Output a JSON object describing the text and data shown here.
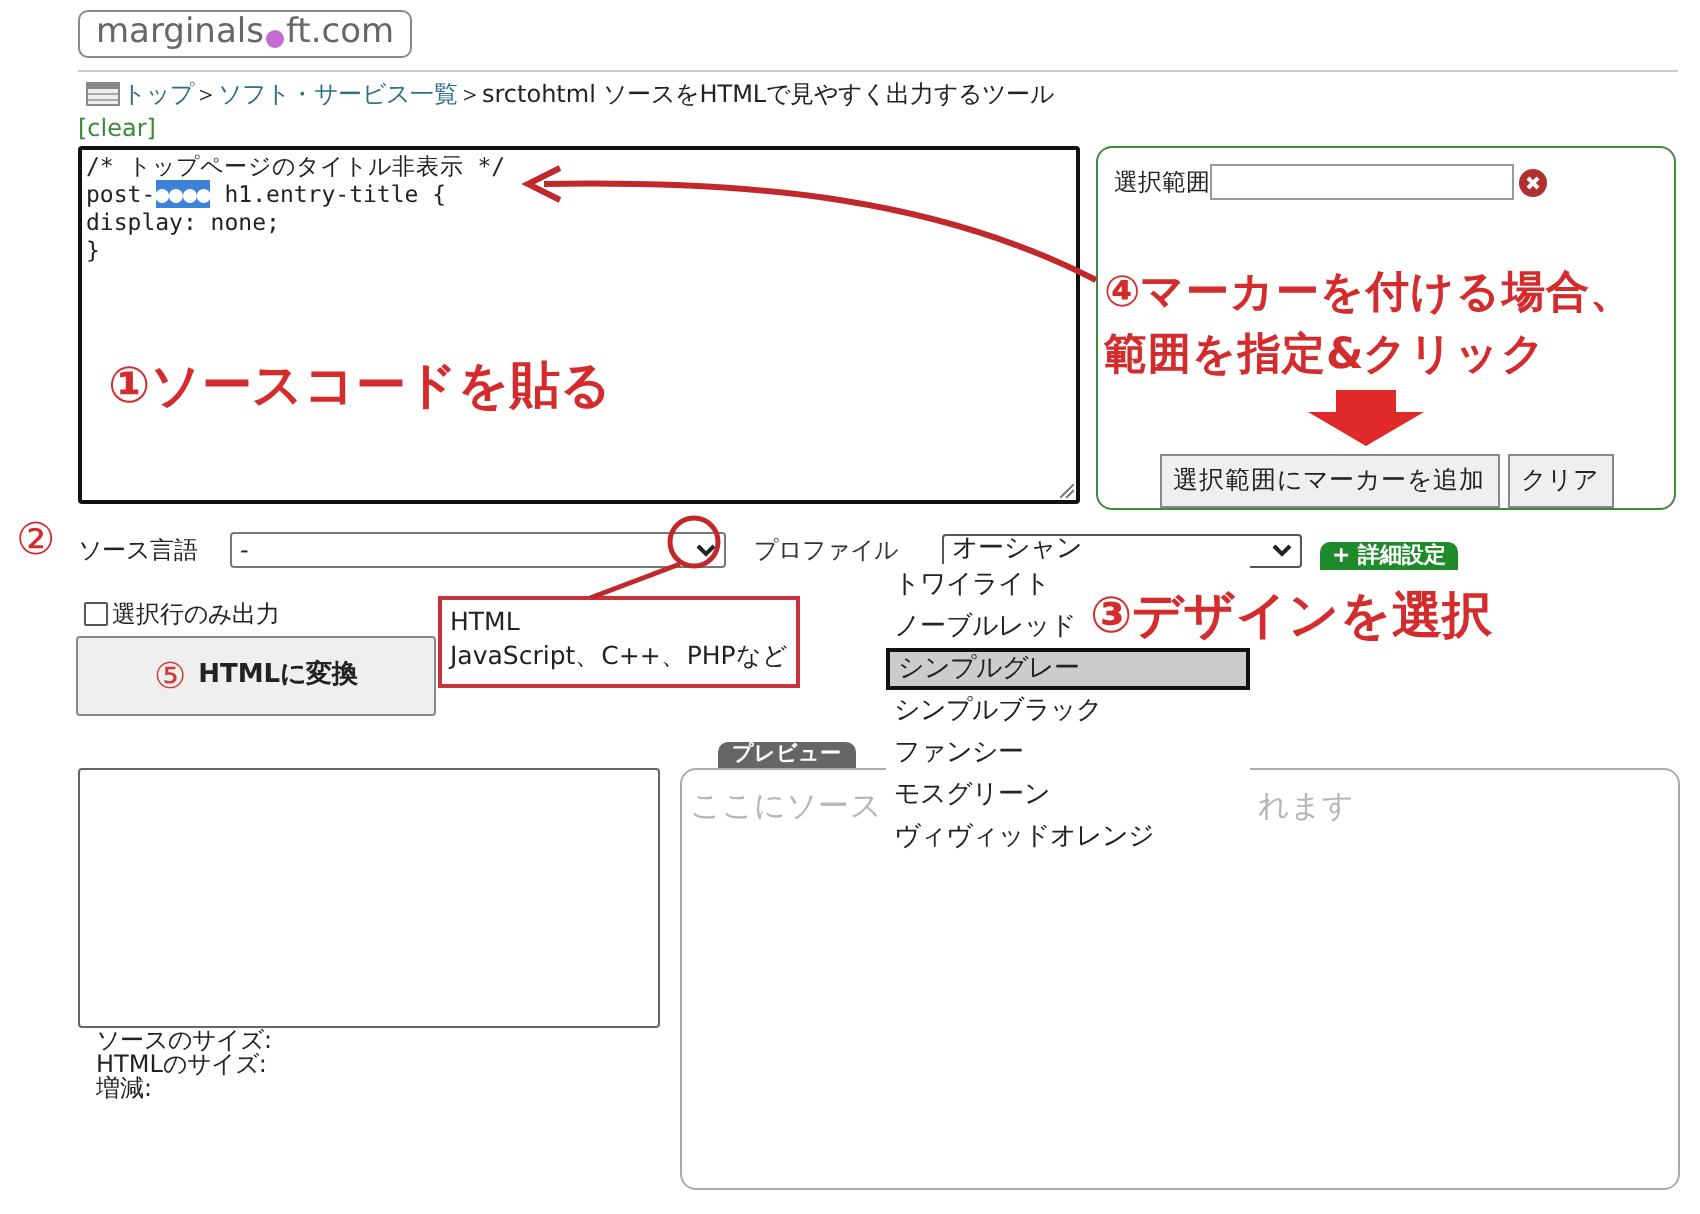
{
  "logo": {
    "text_before": "marginals",
    "text_after": "ft.com"
  },
  "breadcrumb": [
    {
      "kind": "link",
      "text": "トップ"
    },
    {
      "kind": "sep",
      "text": "＞"
    },
    {
      "kind": "link",
      "text": "ソフト・サービス一覧"
    },
    {
      "kind": "sep",
      "text": "＞"
    },
    {
      "kind": "current",
      "text": "srctohtml ソースをHTMLで見やすく出力するツール"
    }
  ],
  "clear_link": "[clear]",
  "source_editor": {
    "lines": [
      {
        "segments": [
          {
            "text": "/* トップページのタイトル非表示 */",
            "selected": false
          }
        ]
      },
      {
        "segments": [
          {
            "text": "post-",
            "selected": false
          },
          {
            "text": "●●●●",
            "selected": true
          },
          {
            "text": " h1.entry-title {",
            "selected": false
          }
        ]
      },
      {
        "segments": [
          {
            "text": "display: none;",
            "selected": false
          }
        ]
      },
      {
        "segments": [
          {
            "text": "}",
            "selected": false
          }
        ]
      }
    ]
  },
  "marker_panel": {
    "label": "選択範囲",
    "buttons": [
      "選択範囲にマーカーを追加",
      "クリア"
    ]
  },
  "source_language": {
    "label": "ソース言語",
    "value": "-"
  },
  "profile": {
    "label": "プロファイル",
    "value": "オーシャン",
    "options": [
      {
        "text": "トワイライト",
        "selected": false
      },
      {
        "text": "ノーブルレッド",
        "selected": false
      },
      {
        "text": "シンプルグレー",
        "selected": true
      },
      {
        "text": "シンプルブラック",
        "selected": false
      },
      {
        "text": "ファンシー",
        "selected": false
      },
      {
        "text": "モスグリーン",
        "selected": false
      },
      {
        "text": "ヴィヴィッドオレンジ",
        "selected": false
      }
    ]
  },
  "advanced_button": {
    "icon": "+",
    "label": "詳細設定"
  },
  "selected_lines_only": {
    "label": "選択行のみ出力",
    "checked": false
  },
  "convert_button": {
    "step": "⑤",
    "label": "HTMLに変換"
  },
  "callout": {
    "lines": [
      "HTML",
      "JavaScript、C++、PHPなど"
    ]
  },
  "stats": [
    "ソースのサイズ:",
    "HTMLのサイズ:",
    "増減:"
  ],
  "preview": {
    "tab": "プレビュー",
    "placeholder_parts": [
      "ここにソース",
      "れます"
    ]
  },
  "annotations": [
    {
      "kind": "big",
      "lines": [
        "④マーカーを付ける場合、",
        "範囲を指定&クリック"
      ]
    },
    {
      "kind": "big",
      "lines": [
        "①ソースコードを貼る"
      ]
    },
    {
      "kind": "circle",
      "lines": [
        "②"
      ]
    },
    {
      "kind": "big",
      "lines": [
        "③デザインを選択"
      ]
    }
  ]
}
